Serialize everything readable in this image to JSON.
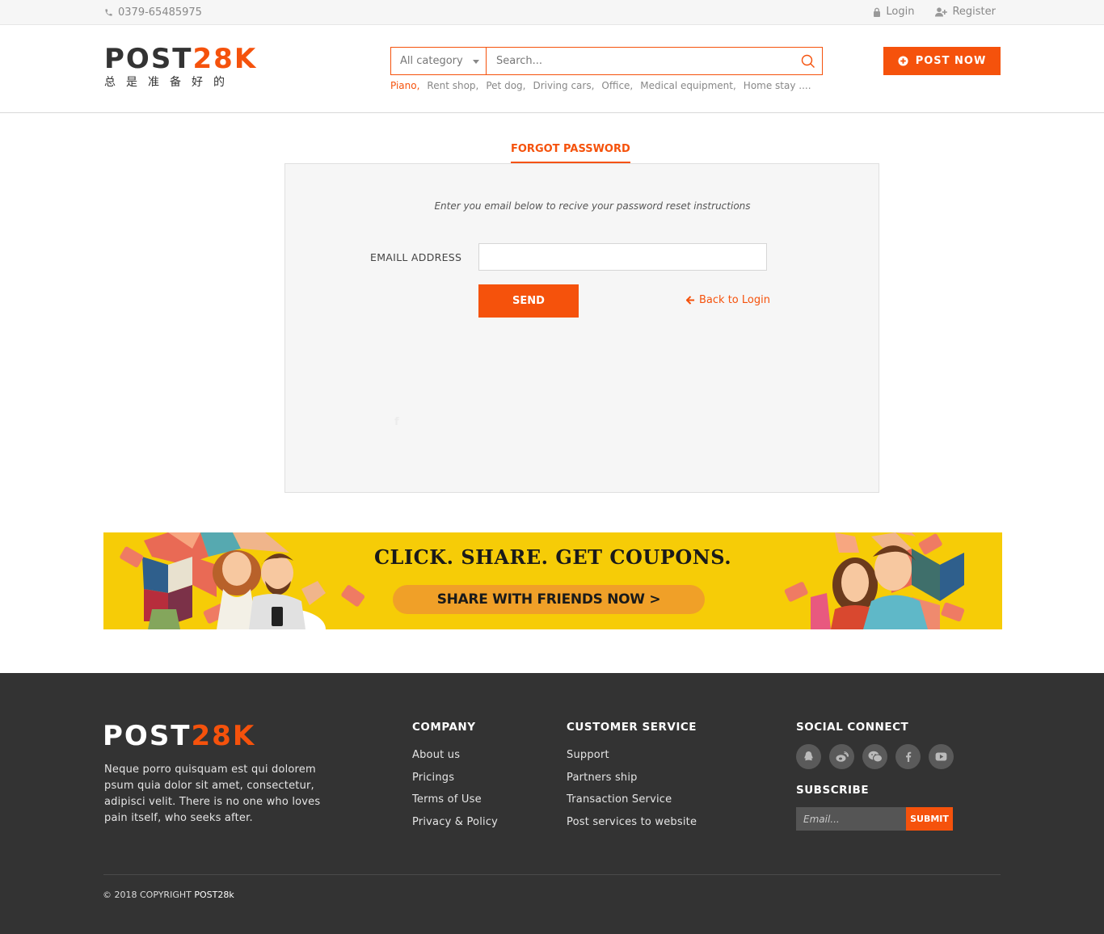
{
  "topbar": {
    "phone": "0379-65485975",
    "login": "Login",
    "register": "Register"
  },
  "header": {
    "logo_main": "POST",
    "logo_accent": "28K",
    "logo_sub": "总是准备好的",
    "search": {
      "category": "All category",
      "placeholder": "Search..."
    },
    "tags": [
      "Piano,",
      "Rent shop,",
      "Pet dog,",
      "Driving cars,",
      "Office,",
      "Medical equipment,",
      "Home stay ...."
    ],
    "post_now": "POST NOW"
  },
  "main": {
    "title": "FORGOT PASSWORD",
    "instructions": "Enter you email below to recive your password reset instructions",
    "email_label": "EMAILL ADDRESS",
    "email_value": "",
    "send": "SEND",
    "back": "Back to Login"
  },
  "banner": {
    "headline": "CLICK. SHARE. GET COUPONS.",
    "button": "SHARE WITH FRIENDS NOW  >"
  },
  "footer": {
    "logo_main": "POST",
    "logo_accent": "28K",
    "description": "Neque porro quisquam est qui dolorem psum quia dolor sit amet, consectetur, adipisci velit. There is no one who loves pain itself, who seeks after.",
    "company": {
      "title": "COMPANY",
      "links": [
        "About us",
        "Pricings",
        "Terms of Use",
        "Privacy & Policy"
      ]
    },
    "customer_service": {
      "title": "CUSTOMER SERVICE",
      "links": [
        "Support",
        "Partners ship",
        "Transaction Service",
        "Post services to website"
      ]
    },
    "social": {
      "title": "SOCIAL CONNECT",
      "icons": [
        "qq-icon",
        "weibo-icon",
        "wechat-icon",
        "facebook-icon",
        "youtube-icon"
      ]
    },
    "subscribe": {
      "title": "SUBSCRIBE",
      "placeholder": "Email...",
      "button": "SUBMIT"
    },
    "copyright": "© 2018 COPYRIGHT",
    "copyright_brand": "POST28k"
  },
  "colors": {
    "accent": "#f5520c",
    "footer_bg": "#333333",
    "banner_bg": "#f6cc07"
  }
}
